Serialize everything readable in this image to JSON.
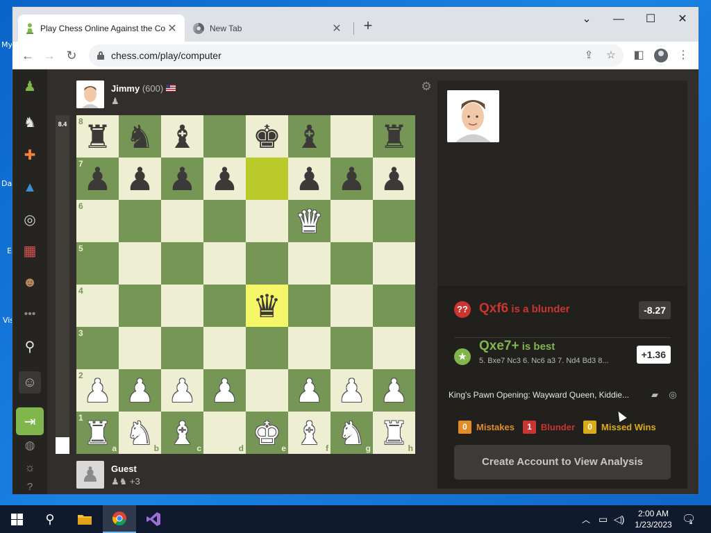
{
  "desktop": {
    "labels": [
      "My",
      "Da",
      "E",
      "Vis"
    ]
  },
  "browser": {
    "tabs": [
      {
        "title": "Play Chess Online Against the Co",
        "active": true,
        "icon": "chess-pawn-favicon"
      },
      {
        "title": "New Tab",
        "active": false,
        "icon": "chrome-favicon"
      }
    ],
    "url": "chess.com/play/computer",
    "window_controls": [
      "chevron-down",
      "minimize",
      "maximize",
      "close"
    ]
  },
  "sidebar": {
    "items": [
      "chess-com-logo-icon",
      "play-icon",
      "puzzles-icon",
      "learn-icon",
      "watch-icon",
      "news-icon",
      "social-icon",
      "more-icon",
      "search-icon",
      "settings-icon-user",
      "login-icon",
      "language-icon",
      "theme-icon",
      "help-icon"
    ]
  },
  "top_player": {
    "name": "Jimmy",
    "rating": "(600)",
    "country": "US"
  },
  "bottom_player": {
    "name": "Guest",
    "captured_extra": "+3"
  },
  "eval_bar": {
    "score": "8.4",
    "white_fraction": 0.05
  },
  "board": {
    "ranks": [
      "8",
      "7",
      "6",
      "5",
      "4",
      "3",
      "2",
      "1"
    ],
    "files": [
      "a",
      "b",
      "c",
      "d",
      "e",
      "f",
      "g",
      "h"
    ],
    "position": [
      [
        "br",
        "bn",
        "bb",
        "",
        "bk",
        "bb",
        "",
        "br"
      ],
      [
        "bp",
        "bp",
        "bp",
        "bp",
        "",
        "bp",
        "bp",
        "bp"
      ],
      [
        "",
        "",
        "",
        "",
        "",
        "wq",
        "",
        ""
      ],
      [
        "",
        "",
        "",
        "",
        "",
        "",
        "",
        ""
      ],
      [
        "",
        "",
        "",
        "",
        "bq",
        "",
        "",
        ""
      ],
      [
        "",
        "",
        "",
        "",
        "",
        "",
        "",
        ""
      ],
      [
        "wp",
        "wp",
        "wp",
        "wp",
        "",
        "wp",
        "wp",
        "wp"
      ],
      [
        "wr",
        "wn",
        "wb",
        "",
        "wk",
        "wb",
        "wn",
        "wr"
      ]
    ],
    "highlights": [
      "e7",
      "e4"
    ]
  },
  "review": {
    "blunder_move": "Qxf6",
    "blunder_text": " is a blunder",
    "blunder_score": "-8.27",
    "best_move": "Qxe7+",
    "best_text": " is best",
    "best_score": "+1.36",
    "best_line": "5. Bxe7 Nc3 6. Nc6 a3 7. Nd4 Bd3 8...",
    "opening": "King's Pawn Opening: Wayward Queen, Kiddie...",
    "stats": {
      "mistakes_count": "0",
      "mistakes_label": "Mistakes",
      "blunder_count": "1",
      "blunder_label": "Blunder",
      "missed_count": "0",
      "missed_label": "Missed Wins"
    },
    "cta": "Create Account to View Analysis"
  },
  "taskbar": {
    "time": "2:00 AM",
    "date": "1/23/2023",
    "notifications": "1"
  },
  "colors": {
    "light_square": "#eeeed2",
    "dark_square": "#769656",
    "blunder": "#ca3431",
    "best": "#81b64c"
  }
}
